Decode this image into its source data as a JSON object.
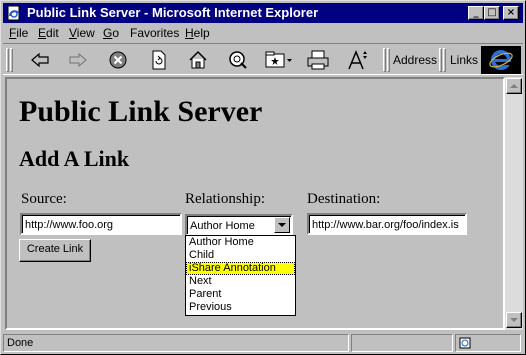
{
  "window": {
    "title": "Public Link Server - Microsoft Internet Explorer",
    "controls": {
      "minimize": "_",
      "maximize": "□",
      "close": "×"
    }
  },
  "menu": [
    {
      "key": "F",
      "rest": "ile"
    },
    {
      "key": "E",
      "rest": "dit"
    },
    {
      "key": "V",
      "rest": "iew"
    },
    {
      "key": "G",
      "rest": "o"
    },
    {
      "key": "",
      "rest": "Favorites"
    },
    {
      "key": "H",
      "rest": "elp"
    }
  ],
  "toolbar": {
    "address_label": "Address",
    "links_label": "Links",
    "icons": [
      "back-arrow-icon",
      "forward-arrow-icon",
      "stop-icon",
      "refresh-icon",
      "home-icon",
      "search-icon",
      "favorites-icon",
      "print-icon",
      "font-icon"
    ]
  },
  "page": {
    "title": "Public Link Server",
    "section_title": "Add A Link",
    "source": {
      "label": "Source:",
      "value": "http://www.foo.org"
    },
    "relationship": {
      "label": "Relationship:",
      "selected": "Author Home",
      "options": [
        "Author Home",
        "Child",
        "iShare Annotation",
        "Next",
        "Parent",
        "Previous"
      ],
      "highlighted_index": 2,
      "highlight_color": "#ffff00"
    },
    "destination": {
      "label": "Destination:",
      "value": "http://www.bar.org/foo/index.is"
    },
    "create_button": "Create Link"
  },
  "status": {
    "text": "Done"
  },
  "colors": {
    "titlebar": "#000080",
    "chrome": "#c0c0c0"
  }
}
